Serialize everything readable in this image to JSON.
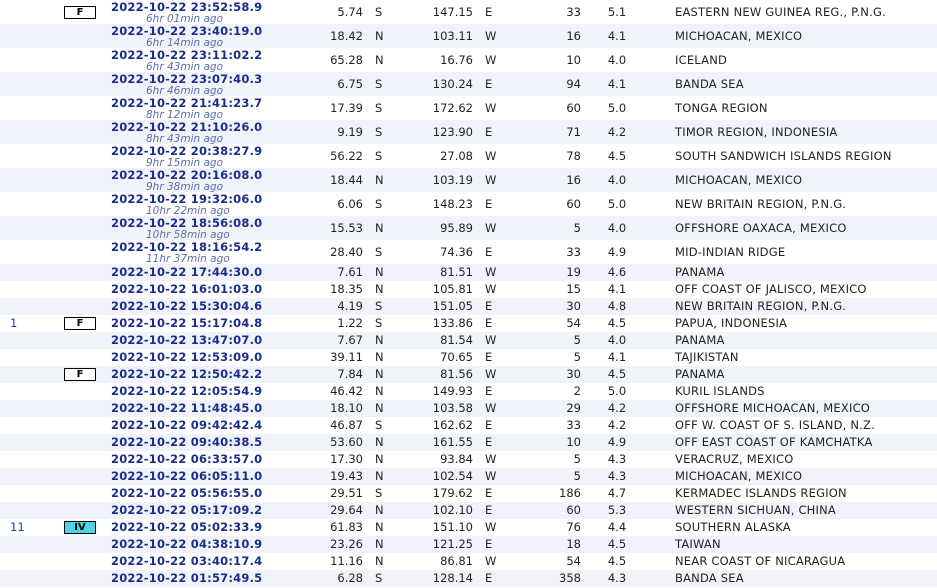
{
  "rows": [
    {
      "rep": "",
      "int": "F",
      "dt": "2022-10-22   23:52:58.9",
      "ago": "6hr 01min ago",
      "lat": "5.74",
      "ns": "S",
      "lon": "147.15",
      "ew": "E",
      "depth": "33",
      "mag": "5.1",
      "region": "EASTERN NEW GUINEA REG., P.N.G."
    },
    {
      "rep": "",
      "int": "",
      "dt": "2022-10-22   23:40:19.0",
      "ago": "6hr 14min ago",
      "lat": "18.42",
      "ns": "N",
      "lon": "103.11",
      "ew": "W",
      "depth": "16",
      "mag": "4.1",
      "region": "MICHOACAN, MEXICO"
    },
    {
      "rep": "",
      "int": "",
      "dt": "2022-10-22   23:11:02.2",
      "ago": "6hr 43min ago",
      "lat": "65.28",
      "ns": "N",
      "lon": "16.76",
      "ew": "W",
      "depth": "10",
      "mag": "4.0",
      "region": "ICELAND"
    },
    {
      "rep": "",
      "int": "",
      "dt": "2022-10-22   23:07:40.3",
      "ago": "6hr 46min ago",
      "lat": "6.75",
      "ns": "S",
      "lon": "130.24",
      "ew": "E",
      "depth": "94",
      "mag": "4.1",
      "region": "BANDA SEA"
    },
    {
      "rep": "",
      "int": "",
      "dt": "2022-10-22   21:41:23.7",
      "ago": "8hr 12min ago",
      "lat": "17.39",
      "ns": "S",
      "lon": "172.62",
      "ew": "W",
      "depth": "60",
      "mag": "5.0",
      "region": "TONGA REGION"
    },
    {
      "rep": "",
      "int": "",
      "dt": "2022-10-22   21:10:26.0",
      "ago": "8hr 43min ago",
      "lat": "9.19",
      "ns": "S",
      "lon": "123.90",
      "ew": "E",
      "depth": "71",
      "mag": "4.2",
      "region": "TIMOR REGION, INDONESIA"
    },
    {
      "rep": "",
      "int": "",
      "dt": "2022-10-22   20:38:27.9",
      "ago": "9hr 15min ago",
      "lat": "56.22",
      "ns": "S",
      "lon": "27.08",
      "ew": "W",
      "depth": "78",
      "mag": "4.5",
      "region": "SOUTH SANDWICH ISLANDS REGION"
    },
    {
      "rep": "",
      "int": "",
      "dt": "2022-10-22   20:16:08.0",
      "ago": "9hr 38min ago",
      "lat": "18.44",
      "ns": "N",
      "lon": "103.19",
      "ew": "W",
      "depth": "16",
      "mag": "4.0",
      "region": "MICHOACAN, MEXICO"
    },
    {
      "rep": "",
      "int": "",
      "dt": "2022-10-22   19:32:06.0",
      "ago": "10hr 22min ago",
      "lat": "6.06",
      "ns": "S",
      "lon": "148.23",
      "ew": "E",
      "depth": "60",
      "mag": "5.0",
      "region": "NEW BRITAIN REGION, P.N.G."
    },
    {
      "rep": "",
      "int": "",
      "dt": "2022-10-22   18:56:08.0",
      "ago": "10hr 58min ago",
      "lat": "15.53",
      "ns": "N",
      "lon": "95.89",
      "ew": "W",
      "depth": "5",
      "mag": "4.0",
      "region": "OFFSHORE OAXACA, MEXICO"
    },
    {
      "rep": "",
      "int": "",
      "dt": "2022-10-22   18:16:54.2",
      "ago": "11hr 37min ago",
      "lat": "28.40",
      "ns": "S",
      "lon": "74.36",
      "ew": "E",
      "depth": "33",
      "mag": "4.9",
      "region": "MID-INDIAN RIDGE"
    },
    {
      "rep": "",
      "int": "",
      "dt": "2022-10-22   17:44:30.0",
      "ago": "",
      "lat": "7.61",
      "ns": "N",
      "lon": "81.51",
      "ew": "W",
      "depth": "19",
      "mag": "4.6",
      "region": "PANAMA"
    },
    {
      "rep": "",
      "int": "",
      "dt": "2022-10-22   16:01:03.0",
      "ago": "",
      "lat": "18.35",
      "ns": "N",
      "lon": "105.81",
      "ew": "W",
      "depth": "15",
      "mag": "4.1",
      "region": "OFF COAST OF JALISCO, MEXICO"
    },
    {
      "rep": "",
      "int": "",
      "dt": "2022-10-22   15:30:04.6",
      "ago": "",
      "lat": "4.19",
      "ns": "S",
      "lon": "151.05",
      "ew": "E",
      "depth": "30",
      "mag": "4.8",
      "region": "NEW BRITAIN REGION, P.N.G."
    },
    {
      "rep": "1",
      "int": "F",
      "dt": "2022-10-22   15:17:04.8",
      "ago": "",
      "lat": "1.22",
      "ns": "S",
      "lon": "133.86",
      "ew": "E",
      "depth": "54",
      "mag": "4.5",
      "region": "PAPUA, INDONESIA"
    },
    {
      "rep": "",
      "int": "",
      "dt": "2022-10-22   13:47:07.0",
      "ago": "",
      "lat": "7.67",
      "ns": "N",
      "lon": "81.54",
      "ew": "W",
      "depth": "5",
      "mag": "4.0",
      "region": "PANAMA"
    },
    {
      "rep": "",
      "int": "",
      "dt": "2022-10-22   12:53:09.0",
      "ago": "",
      "lat": "39.11",
      "ns": "N",
      "lon": "70.65",
      "ew": "E",
      "depth": "5",
      "mag": "4.1",
      "region": "TAJIKISTAN"
    },
    {
      "rep": "",
      "int": "F",
      "dt": "2022-10-22   12:50:42.2",
      "ago": "",
      "lat": "7.84",
      "ns": "N",
      "lon": "81.56",
      "ew": "W",
      "depth": "30",
      "mag": "4.5",
      "region": "PANAMA"
    },
    {
      "rep": "",
      "int": "",
      "dt": "2022-10-22   12:05:54.9",
      "ago": "",
      "lat": "46.42",
      "ns": "N",
      "lon": "149.93",
      "ew": "E",
      "depth": "2",
      "mag": "5.0",
      "region": "KURIL ISLANDS"
    },
    {
      "rep": "",
      "int": "",
      "dt": "2022-10-22   11:48:45.0",
      "ago": "",
      "lat": "18.10",
      "ns": "N",
      "lon": "103.58",
      "ew": "W",
      "depth": "29",
      "mag": "4.2",
      "region": "OFFSHORE MICHOACAN, MEXICO"
    },
    {
      "rep": "",
      "int": "",
      "dt": "2022-10-22   09:42:42.4",
      "ago": "",
      "lat": "46.87",
      "ns": "S",
      "lon": "162.62",
      "ew": "E",
      "depth": "33",
      "mag": "4.2",
      "region": "OFF W. COAST OF S. ISLAND, N.Z."
    },
    {
      "rep": "",
      "int": "",
      "dt": "2022-10-22   09:40:38.5",
      "ago": "",
      "lat": "53.60",
      "ns": "N",
      "lon": "161.55",
      "ew": "E",
      "depth": "10",
      "mag": "4.9",
      "region": "OFF EAST COAST OF KAMCHATKA"
    },
    {
      "rep": "",
      "int": "",
      "dt": "2022-10-22   06:33:57.0",
      "ago": "",
      "lat": "17.30",
      "ns": "N",
      "lon": "93.84",
      "ew": "W",
      "depth": "5",
      "mag": "4.3",
      "region": "VERACRUZ, MEXICO"
    },
    {
      "rep": "",
      "int": "",
      "dt": "2022-10-22   06:05:11.0",
      "ago": "",
      "lat": "19.43",
      "ns": "N",
      "lon": "102.54",
      "ew": "W",
      "depth": "5",
      "mag": "4.3",
      "region": "MICHOACAN, MEXICO"
    },
    {
      "rep": "",
      "int": "",
      "dt": "2022-10-22   05:56:55.0",
      "ago": "",
      "lat": "29.51",
      "ns": "S",
      "lon": "179.62",
      "ew": "E",
      "depth": "186",
      "mag": "4.7",
      "region": "KERMADEC ISLANDS REGION"
    },
    {
      "rep": "",
      "int": "",
      "dt": "2022-10-22   05:17:09.2",
      "ago": "",
      "lat": "29.64",
      "ns": "N",
      "lon": "102.10",
      "ew": "E",
      "depth": "60",
      "mag": "5.3",
      "region": "WESTERN SICHUAN, CHINA"
    },
    {
      "rep": "11",
      "int": "IV",
      "dt": "2022-10-22   05:02:33.9",
      "ago": "",
      "lat": "61.83",
      "ns": "N",
      "lon": "151.10",
      "ew": "W",
      "depth": "76",
      "mag": "4.4",
      "region": "SOUTHERN ALASKA"
    },
    {
      "rep": "",
      "int": "",
      "dt": "2022-10-22   04:38:10.9",
      "ago": "",
      "lat": "23.26",
      "ns": "N",
      "lon": "121.25",
      "ew": "E",
      "depth": "18",
      "mag": "4.5",
      "region": "TAIWAN"
    },
    {
      "rep": "",
      "int": "",
      "dt": "2022-10-22   03:40:17.4",
      "ago": "",
      "lat": "11.16",
      "ns": "N",
      "lon": "86.81",
      "ew": "W",
      "depth": "54",
      "mag": "4.5",
      "region": "NEAR COAST OF NICARAGUA"
    },
    {
      "rep": "",
      "int": "",
      "dt": "2022-10-22   01:57:49.5",
      "ago": "",
      "lat": "6.28",
      "ns": "S",
      "lon": "128.14",
      "ew": "E",
      "depth": "358",
      "mag": "4.3",
      "region": "BANDA SEA"
    }
  ],
  "colors": {
    "link": "#1a2c8c",
    "ago": "#5b6fa6",
    "stripe": "#f0f4fa",
    "intensity_iv": "#4fd6e6"
  }
}
